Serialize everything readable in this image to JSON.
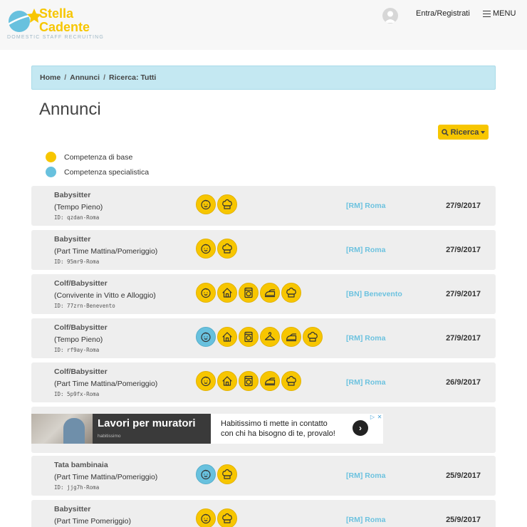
{
  "header": {
    "brand_line1": "Stella",
    "brand_line2": "Cadente",
    "brand_tagline": "DOMESTIC STAFF RECRUITING",
    "login_label": "Entra/Registrati",
    "menu_label": "MENU"
  },
  "breadcrumb": {
    "items": [
      "Home",
      "Annunci",
      "Ricerca: Tutti"
    ],
    "separator": "/"
  },
  "page": {
    "title": "Annunci",
    "search_label": "Ricerca"
  },
  "legend": [
    {
      "label": "Competenza di base",
      "color": "#f7c600"
    },
    {
      "label": "Competenza specialistica",
      "color": "#68c1de"
    }
  ],
  "colors": {
    "accent_yellow": "#f7c600",
    "accent_blue": "#68c1de",
    "breadcrumb_bg": "#c4e8f2"
  },
  "listings": [
    {
      "title": "Babysitter",
      "subtitle": "(Tempo Pieno)",
      "id": "ID: qzdan-Roma",
      "location": "[RM] Roma",
      "date": "27/9/2017",
      "icons": [
        {
          "name": "baby-icon",
          "type": "base"
        },
        {
          "name": "chef-hat-icon",
          "type": "base"
        }
      ]
    },
    {
      "title": "Babysitter",
      "subtitle": "(Part Time Mattina/Pomeriggio)",
      "id": "ID: 95mr9-Roma",
      "location": "[RM] Roma",
      "date": "27/9/2017",
      "icons": [
        {
          "name": "baby-icon",
          "type": "base"
        },
        {
          "name": "chef-hat-icon",
          "type": "base"
        }
      ]
    },
    {
      "title": "Colf/Babysitter",
      "subtitle": "(Convivente in Vitto e Alloggio)",
      "id": "ID: 77zrn-Benevento",
      "location": "[BN] Benevento",
      "date": "27/9/2017",
      "icons": [
        {
          "name": "baby-icon",
          "type": "base"
        },
        {
          "name": "house-icon",
          "type": "base"
        },
        {
          "name": "washing-machine-icon",
          "type": "base"
        },
        {
          "name": "iron-icon",
          "type": "base"
        },
        {
          "name": "chef-hat-icon",
          "type": "base"
        }
      ]
    },
    {
      "title": "Colf/Babysitter",
      "subtitle": "(Tempo Pieno)",
      "id": "ID: rf9ay-Roma",
      "location": "[RM] Roma",
      "date": "27/9/2017",
      "icons": [
        {
          "name": "baby-icon",
          "type": "specialist"
        },
        {
          "name": "house-icon",
          "type": "base"
        },
        {
          "name": "washing-machine-icon",
          "type": "base"
        },
        {
          "name": "hanger-icon",
          "type": "base"
        },
        {
          "name": "iron-icon",
          "type": "base"
        },
        {
          "name": "chef-hat-icon",
          "type": "base"
        }
      ]
    },
    {
      "title": "Colf/Babysitter",
      "subtitle": "(Part Time Mattina/Pomeriggio)",
      "id": "ID: 5p9fx-Roma",
      "location": "[RM] Roma",
      "date": "26/9/2017",
      "icons": [
        {
          "name": "baby-icon",
          "type": "base"
        },
        {
          "name": "house-icon",
          "type": "base"
        },
        {
          "name": "washing-machine-icon",
          "type": "base"
        },
        {
          "name": "iron-icon",
          "type": "base"
        },
        {
          "name": "chef-hat-icon",
          "type": "base"
        }
      ]
    },
    {
      "title": "Tata bambinaia",
      "subtitle": "(Part Time Mattina/Pomeriggio)",
      "id": "ID: jjg7h-Roma",
      "location": "[RM] Roma",
      "date": "25/9/2017",
      "icons": [
        {
          "name": "baby-icon",
          "type": "specialist"
        },
        {
          "name": "chef-hat-icon",
          "type": "base"
        }
      ]
    },
    {
      "title": "Babysitter",
      "subtitle": "(Part Time Pomeriggio)",
      "id": "",
      "location": "[RM] Roma",
      "date": "25/9/2017",
      "icons": [
        {
          "name": "baby-icon",
          "type": "base"
        },
        {
          "name": "chef-hat-icon",
          "type": "base"
        }
      ]
    }
  ],
  "ad": {
    "headline": "Lavori per muratori",
    "brand": "habitissimo",
    "copy_line1": "Habitissimo ti mette in contatto",
    "copy_line2": "con chi ha bisogno di te, provalo!",
    "arrow": "›"
  }
}
